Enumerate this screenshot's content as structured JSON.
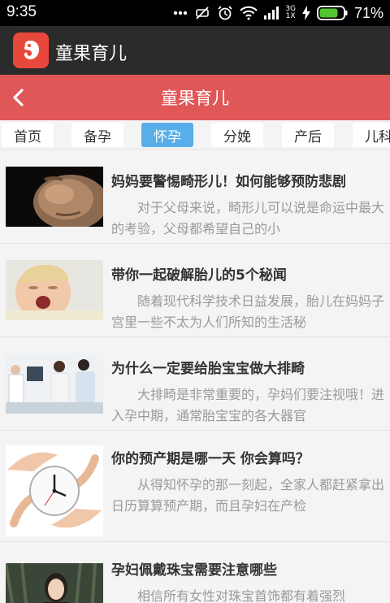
{
  "status_bar": {
    "time": "9:35",
    "network_top": "3G",
    "network_bottom": "1X",
    "battery_pct": "71%",
    "icons": [
      "more-dots-icon",
      "mute-icon",
      "alarm-icon",
      "wifi-icon",
      "signal-icon",
      "charging-icon",
      "battery-icon"
    ]
  },
  "app_bar": {
    "title": "童果育儿",
    "icon": "fetus-logo-icon"
  },
  "header": {
    "title": "童果育儿",
    "back_icon": "chevron-left-icon"
  },
  "colors": {
    "header_red": "#e05757",
    "tab_active": "#58aee8",
    "app_bar": "#2b2b2b",
    "logo_red": "#e8483c"
  },
  "tabs": [
    {
      "label": "首页",
      "active": false
    },
    {
      "label": "备孕",
      "active": false
    },
    {
      "label": "怀孕",
      "active": true
    },
    {
      "label": "分娩",
      "active": false
    },
    {
      "label": "产后",
      "active": false
    },
    {
      "label": "儿科",
      "active": false
    }
  ],
  "articles": [
    {
      "title": "妈妈要警惕畸形儿！如何能够预防悲剧",
      "desc": "对于父母来说，畸形儿可以说是命运中最大的考验，父母都希望自己的小",
      "thumb": "pregnant-belly-image"
    },
    {
      "title": "带你一起破解胎儿的5个秘闻",
      "desc": "随着现代科学技术日益发展，胎儿在妈妈子宫里一些不太为人们所知的生活秘",
      "thumb": "crying-baby-image"
    },
    {
      "title": "为什么一定要给胎宝宝做大排畸",
      "desc": "大排畸是非常重要的，孕妈们要注视哦！进入孕中期，通常胎宝宝的各大器官",
      "thumb": "doctor-couple-image"
    },
    {
      "title": "你的预产期是哪一天 你会算吗？",
      "desc": "从得知怀孕的那一刻起，全家人都赶紧拿出日历算算预产期，而且孕妇在产检",
      "thumb": "hands-clock-image"
    },
    {
      "title": "孕妇佩戴珠宝需要注意哪些",
      "desc": "相信所有女性对珠宝首饰都有着强烈",
      "thumb": "woman-portrait-image"
    }
  ]
}
